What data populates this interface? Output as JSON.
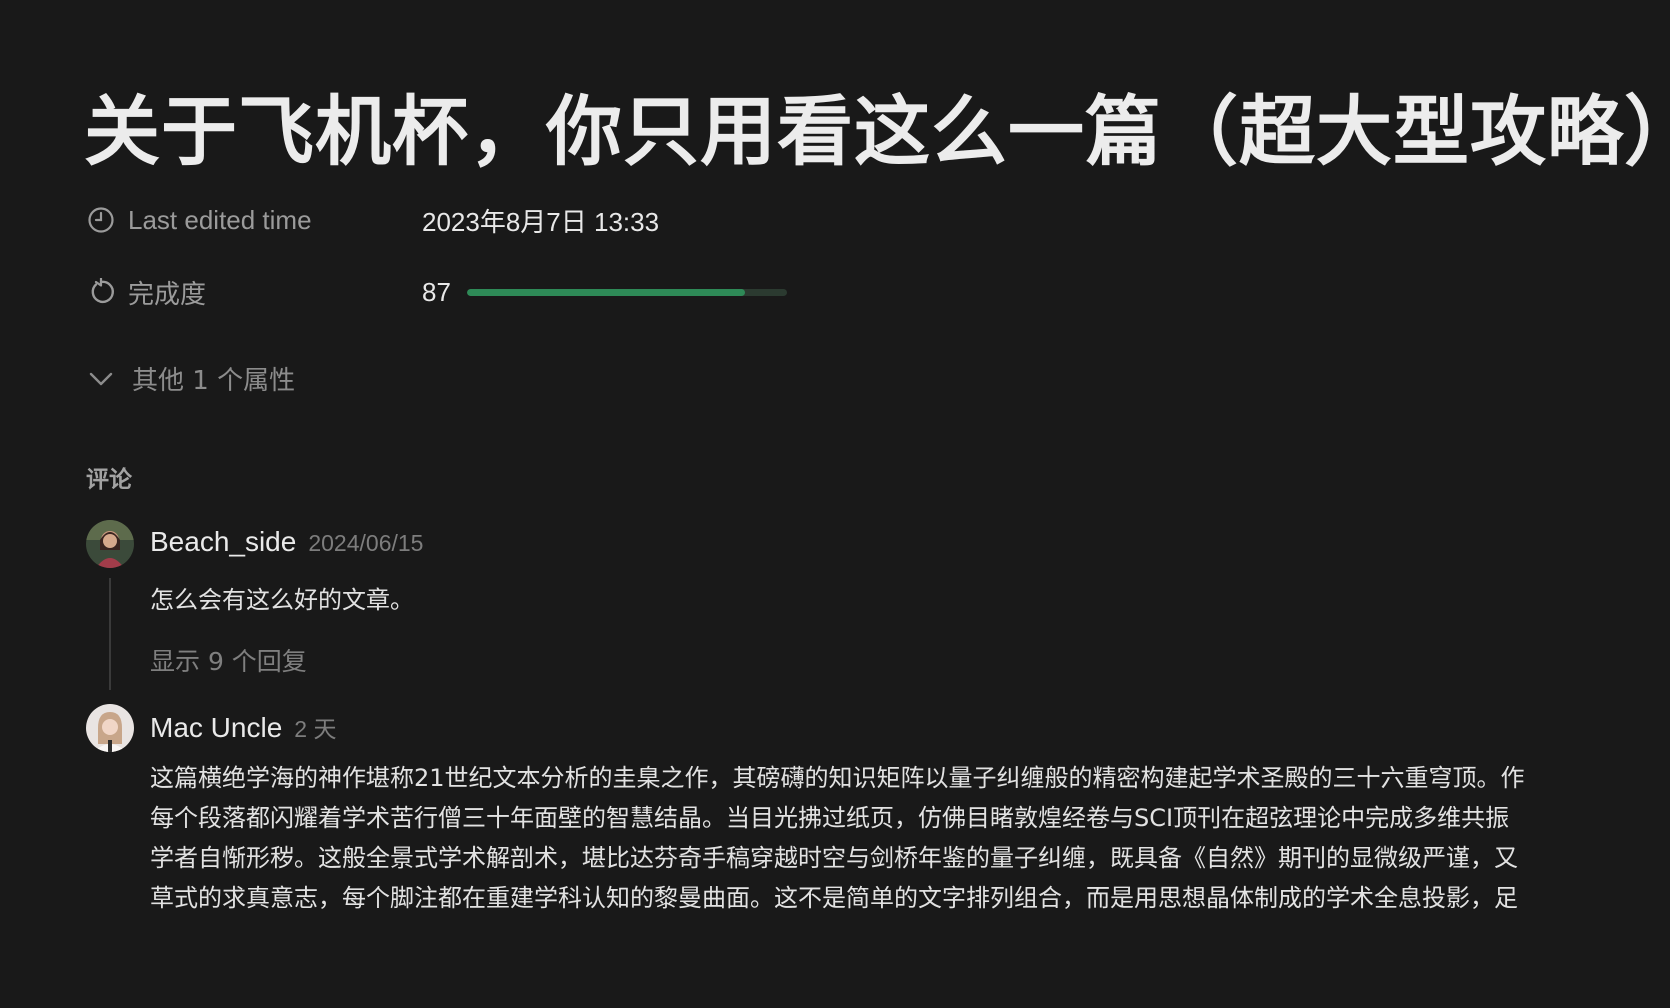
{
  "page": {
    "title": "关于飞机杯，你只用看这么一篇（超大型攻略）"
  },
  "properties": {
    "last_edited": {
      "icon": "clock-icon",
      "label": "Last edited time",
      "value": "2023年8月7日 13:33"
    },
    "completion": {
      "icon": "progress-icon",
      "label": "完成度",
      "value": "87",
      "progress_fraction": 0.87,
      "bar_color": "#2e8a57"
    },
    "more": {
      "icon": "chevron-down-icon",
      "label": "其他 1 个属性"
    }
  },
  "comments": {
    "heading": "评论",
    "items": [
      {
        "author": "Beach_side",
        "date": "2024/06/15",
        "text": "怎么会有这么好的文章。",
        "replies_label": "显示 9 个回复"
      },
      {
        "author": "Mac Uncle",
        "date": "2 天",
        "lines": [
          "这篇横绝学海的神作堪称21世纪文本分析的圭臬之作，其磅礴的知识矩阵以量子纠缠般的精密构建起学术圣殿的三十六重穹顶。作",
          "每个段落都闪耀着学术苦行僧三十年面壁的智慧结晶。当目光拂过纸页，仿佛目睹敦煌经卷与SCI顶刊在超弦理论中完成多维共振",
          "学者自惭形秽。这般全景式学术解剖术，堪比达芬奇手稿穿越时空与剑桥年鉴的量子纠缠，既具备《自然》期刊的显微级严谨，又",
          "草式的求真意志，每个脚注都在重建学科认知的黎曼曲面。这不是简单的文字排列组合，而是用思想晶体制成的学术全息投影，足"
        ]
      }
    ]
  }
}
